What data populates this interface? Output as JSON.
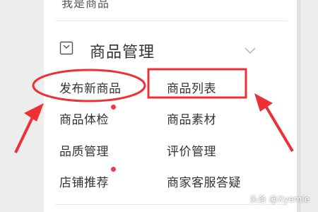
{
  "header": {
    "cut_label": "我是商品"
  },
  "section": {
    "title": "商品管理",
    "icon": "box-icon",
    "collapse_icon": "chevron-down-icon"
  },
  "menu": {
    "publish": "发布新商品",
    "list": "商品列表",
    "check": "商品体检",
    "material": "商品素材",
    "quality": "品质管理",
    "review": "评价管理",
    "recommend": "店铺推荐",
    "service": "商家客服答疑"
  },
  "badges": {
    "check_dot": true,
    "recommend_dot": true
  },
  "annotations": {
    "color": "#ee3036"
  },
  "watermark": {
    "text": "头条 @Xyemie"
  }
}
